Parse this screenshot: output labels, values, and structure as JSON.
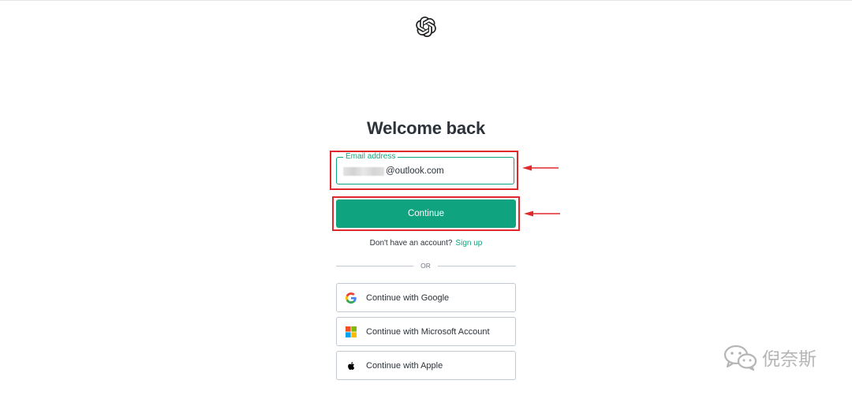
{
  "page": {
    "logo_icon": "openai-logo-icon",
    "title": "Welcome back"
  },
  "email": {
    "label": "Email address",
    "value_visible_suffix": "@outlook.com"
  },
  "continue_button": {
    "label": "Continue"
  },
  "signup": {
    "prompt": "Don't have an account?",
    "link": "Sign up"
  },
  "divider": {
    "text": "OR"
  },
  "social": [
    {
      "icon": "google-icon",
      "label": "Continue with Google"
    },
    {
      "icon": "microsoft-icon",
      "label": "Continue with Microsoft Account"
    },
    {
      "icon": "apple-icon",
      "label": "Continue with Apple"
    }
  ],
  "watermark": {
    "text": "倪奈斯",
    "icon": "wechat-icon"
  },
  "colors": {
    "accent": "#10a37f",
    "annotation": "#e0282d",
    "text": "#2d333a",
    "border": "#c2c8d0"
  }
}
